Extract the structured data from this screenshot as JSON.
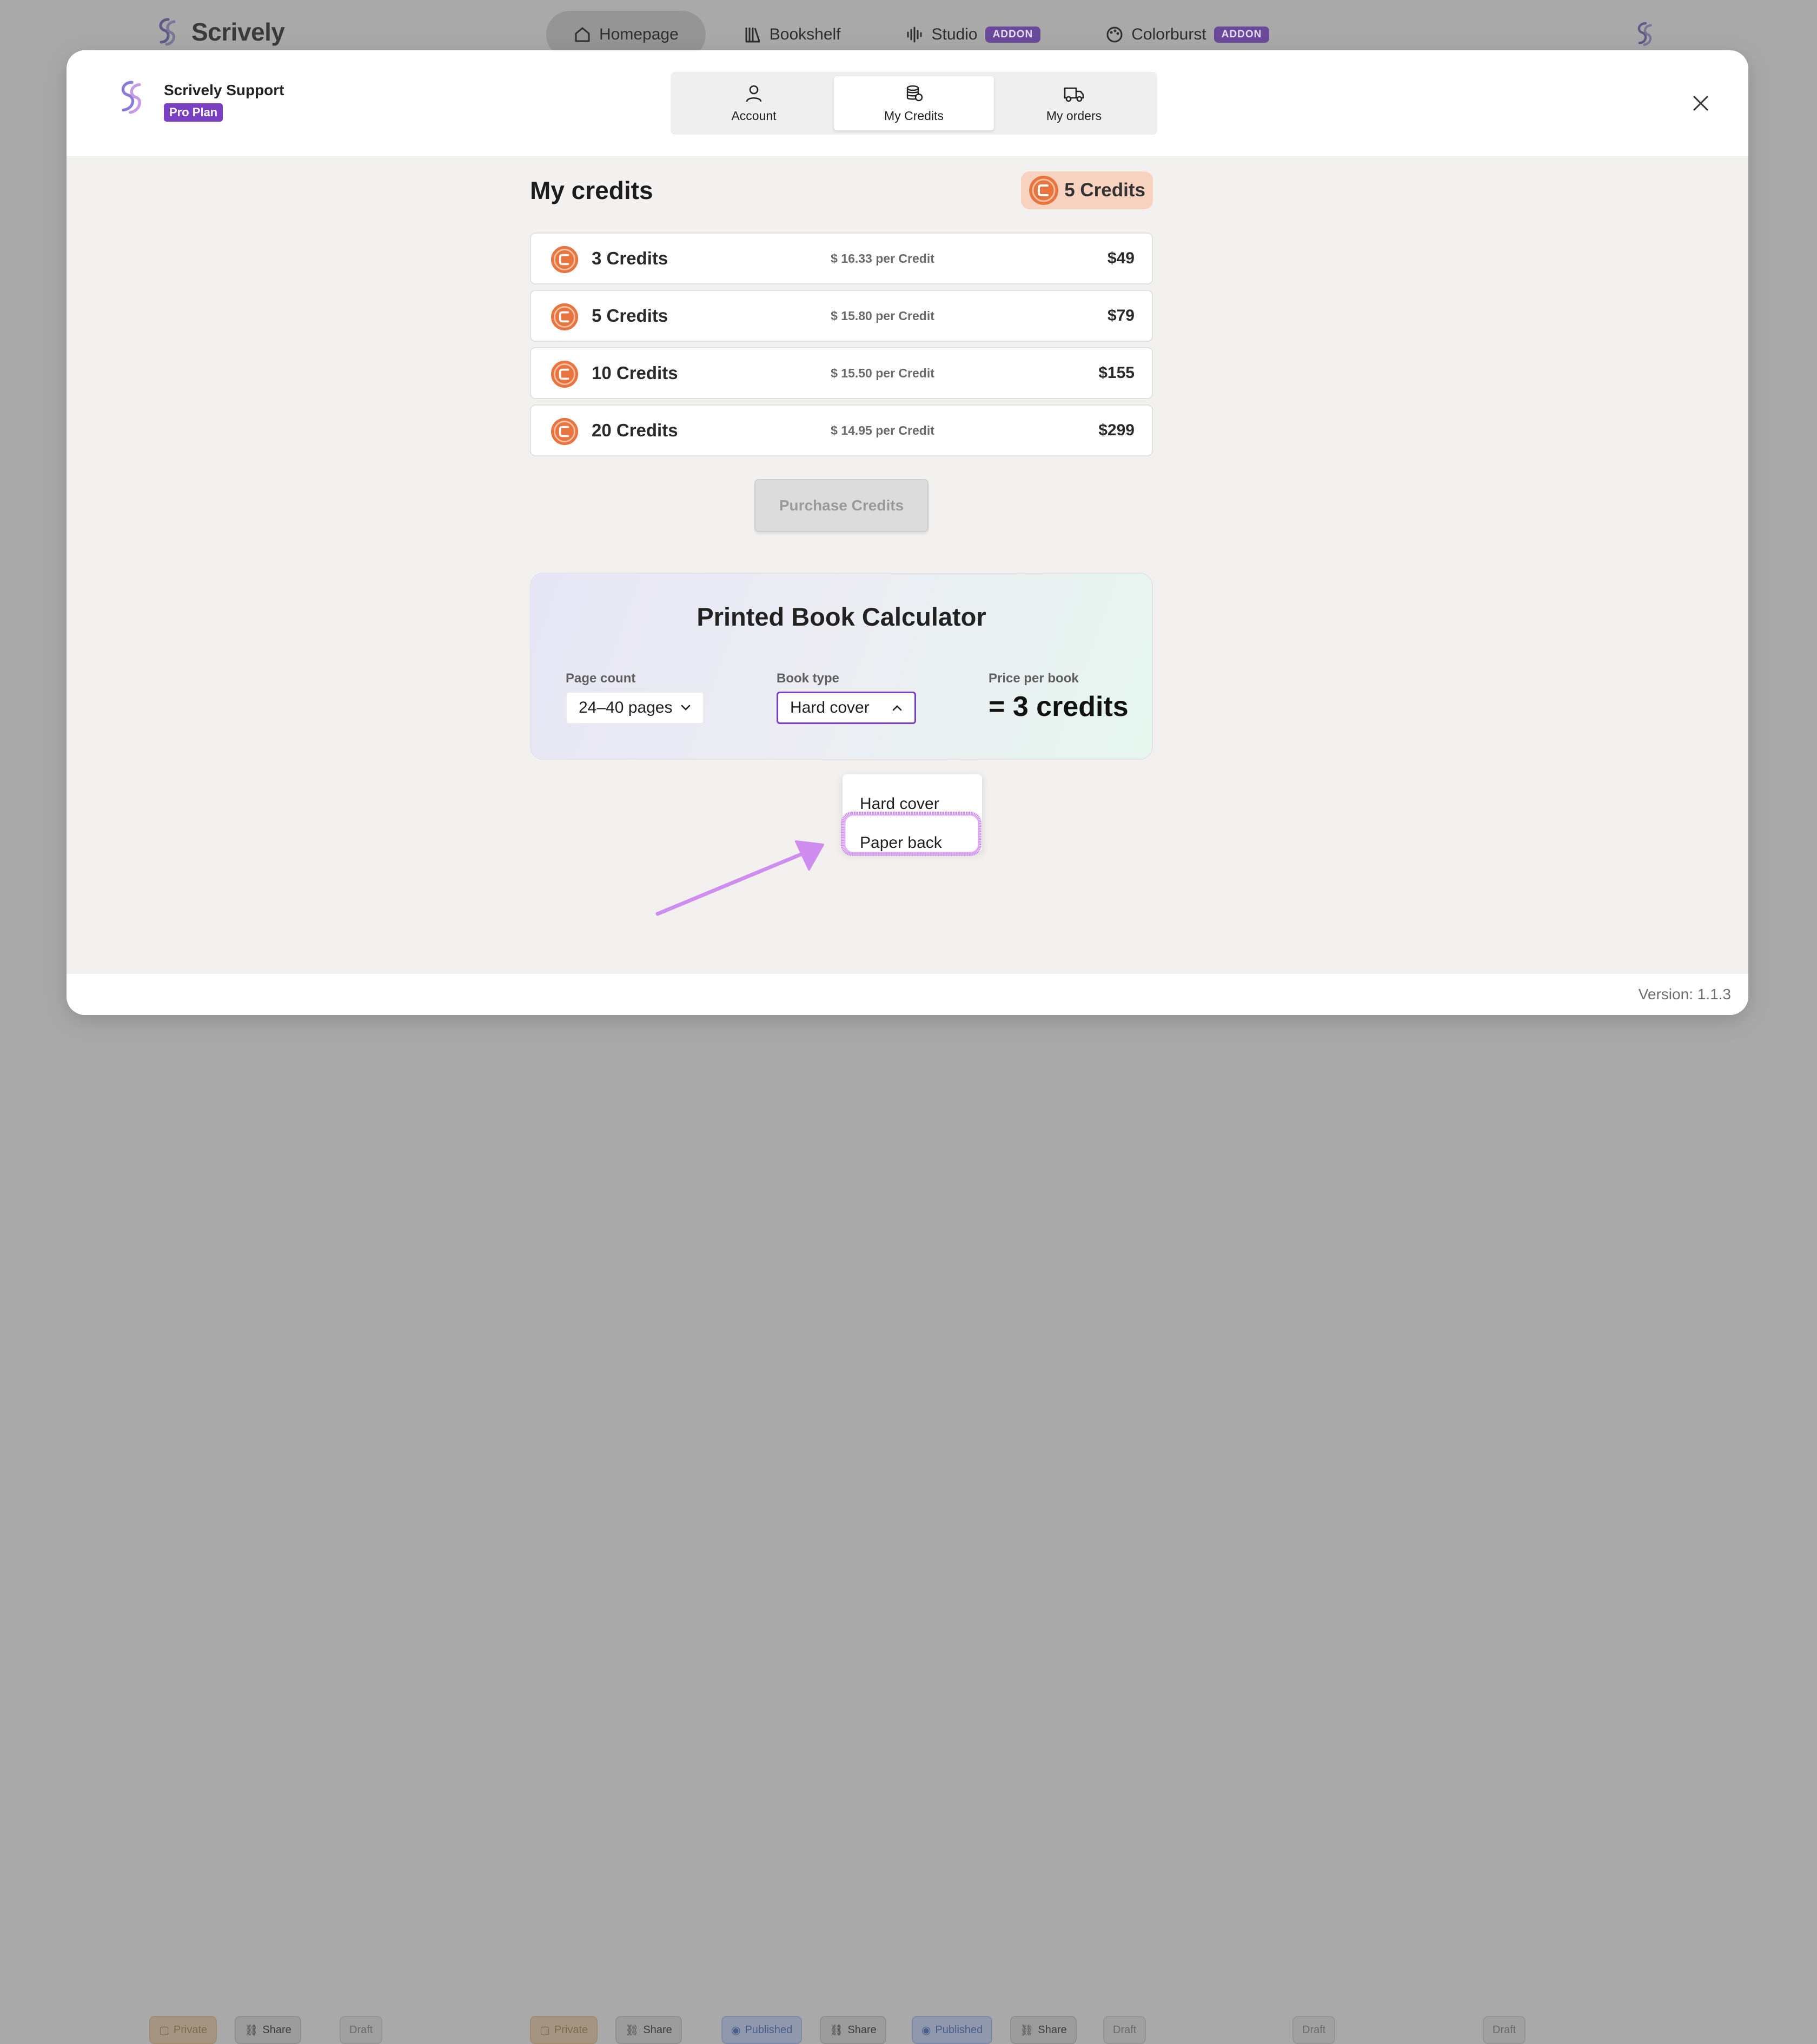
{
  "background": {
    "brand": "Scrively",
    "nav": [
      {
        "label": "Homepage",
        "icon": "home-icon",
        "addon": ""
      },
      {
        "label": "Bookshelf",
        "icon": "books-icon",
        "addon": ""
      },
      {
        "label": "Studio",
        "icon": "audio-wave-icon",
        "addon": "ADDON"
      },
      {
        "label": "Colorburst",
        "icon": "palette-icon",
        "addon": "ADDON"
      }
    ],
    "chips": {
      "private": "Private",
      "share": "Share",
      "draft": "Draft",
      "published": "Published"
    }
  },
  "modal": {
    "user_name": "Scrively Support",
    "plan": "Pro Plan",
    "tabs": [
      {
        "label": "Account",
        "icon": "user-icon"
      },
      {
        "label": "My Credits",
        "icon": "coins-icon"
      },
      {
        "label": "My orders",
        "icon": "truck-icon"
      }
    ],
    "active_tab": "My Credits"
  },
  "credits": {
    "title": "My credits",
    "balance": "5 Credits",
    "packages": [
      {
        "name": "3 Credits",
        "per": "$ 16.33 per Credit",
        "price": "$49"
      },
      {
        "name": "5 Credits",
        "per": "$ 15.80 per Credit",
        "price": "$79"
      },
      {
        "name": "10 Credits",
        "per": "$ 15.50 per Credit",
        "price": "$155"
      },
      {
        "name": "20 Credits",
        "per": "$ 14.95 per Credit",
        "price": "$299"
      }
    ],
    "purchase_label": "Purchase Credits"
  },
  "calculator": {
    "title": "Printed Book Calculator",
    "page_count_label": "Page count",
    "page_count_value": "24–40 pages",
    "book_type_label": "Book type",
    "book_type_value": "Hard cover",
    "book_type_options": [
      "Hard cover",
      "Paper back"
    ],
    "price_label": "Price per book",
    "price_value": "= 3 credits"
  },
  "footer": {
    "version": "Version: 1.1.3"
  },
  "colors": {
    "accent": "#7b3fc4",
    "coin": "#e8743f",
    "annotation": "#d08df0"
  }
}
